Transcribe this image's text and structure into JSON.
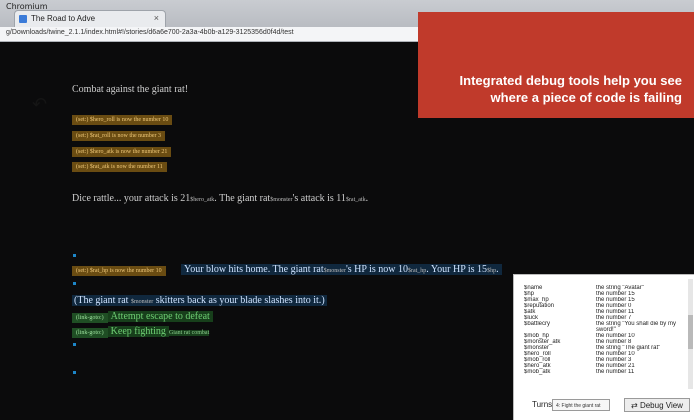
{
  "browser": {
    "window_title": "Chromium",
    "tab_title": "The Road to Adve",
    "tab_close": "×",
    "url": "g/Downloads/twine_2.1.1/index.html#!/stories/d6a6e700-2a3a-4b0b-a129-3125356d0f4d/test",
    "star": "☆",
    "menu": "≡"
  },
  "story": {
    "heading": "Combat against the giant rat!",
    "set_macros": [
      "(set:) $hero_roll is now the number 10",
      "(set:) $rat_roll is now the number 3",
      "(set:) $hero_atk is now the number 21",
      "(set:) $rat_atk is now the number 11"
    ],
    "attack_line": "Dice rattle... your attack is 21",
    "attack_tag": "$hero_atk",
    "attack_mid": ". The giant rat",
    "attack_tag2": "$monster",
    "attack_end": "'s attack is 11",
    "attack_tag3": "$rat_atk",
    "attack_tail": ".",
    "blow_macro": "(set:) $rat_hp is now the number 10",
    "blow_line": "Your blow hits home. The giant rat",
    "blow_tag": "$monster",
    "blow_mid": "'s HP is now 10",
    "blow_tag2": "$rat_hp",
    "blow_mid2": ". Your HP is 15",
    "blow_tag3": "$hp",
    "blow_end": ".",
    "skitter_open": "(",
    "skitter_a": "The giant rat",
    "skitter_tag": "$monster",
    "skitter_b": "skitters back as your blade slashes into it.",
    "skitter_close": ")",
    "link_macro1": "(link-goto:)",
    "link_text1": "Attempt escape to defeat",
    "link_macro2": "(link-goto:)",
    "link_text2": "Keep fighting",
    "link_tag2": "Giant rat combat"
  },
  "callout": {
    "text": "Integrated debug tools help you see where a piece of code is failing"
  },
  "debug_panel": {
    "variables": [
      {
        "name": "$name",
        "value": "the string \"Avatar\""
      },
      {
        "name": "$hp",
        "value": "the number 15"
      },
      {
        "name": "$max_hp",
        "value": "the number 15"
      },
      {
        "name": "$reputation",
        "value": "the number 0"
      },
      {
        "name": "$atk",
        "value": "the number 11"
      },
      {
        "name": "$luck",
        "value": "the number 7"
      },
      {
        "name": "$battlecry",
        "value": "the string \"You shall die by my sword!\""
      },
      {
        "name": "$mob_hp",
        "value": "the number 10"
      },
      {
        "name": "$monster_atk",
        "value": "the number 8"
      },
      {
        "name": "$monster",
        "value": "the string \"The giant rat\""
      },
      {
        "name": "$hero_roll",
        "value": "the number 10"
      },
      {
        "name": "$mob_roll",
        "value": "the number 3"
      },
      {
        "name": "$hero_atk",
        "value": "the number 21"
      },
      {
        "name": "$mob_atk",
        "value": "the number 11"
      }
    ],
    "turns_label": "Turns:",
    "turn_selected": "4: Fight the giant rat",
    "debug_button": "⇄ Debug View"
  },
  "colors": {
    "background": "#0b0b0c",
    "callout": "#c03a2b",
    "set_macro": "#6a4c12",
    "link_macro": "#1f4e24",
    "passage_marker": "#1d86c8"
  }
}
